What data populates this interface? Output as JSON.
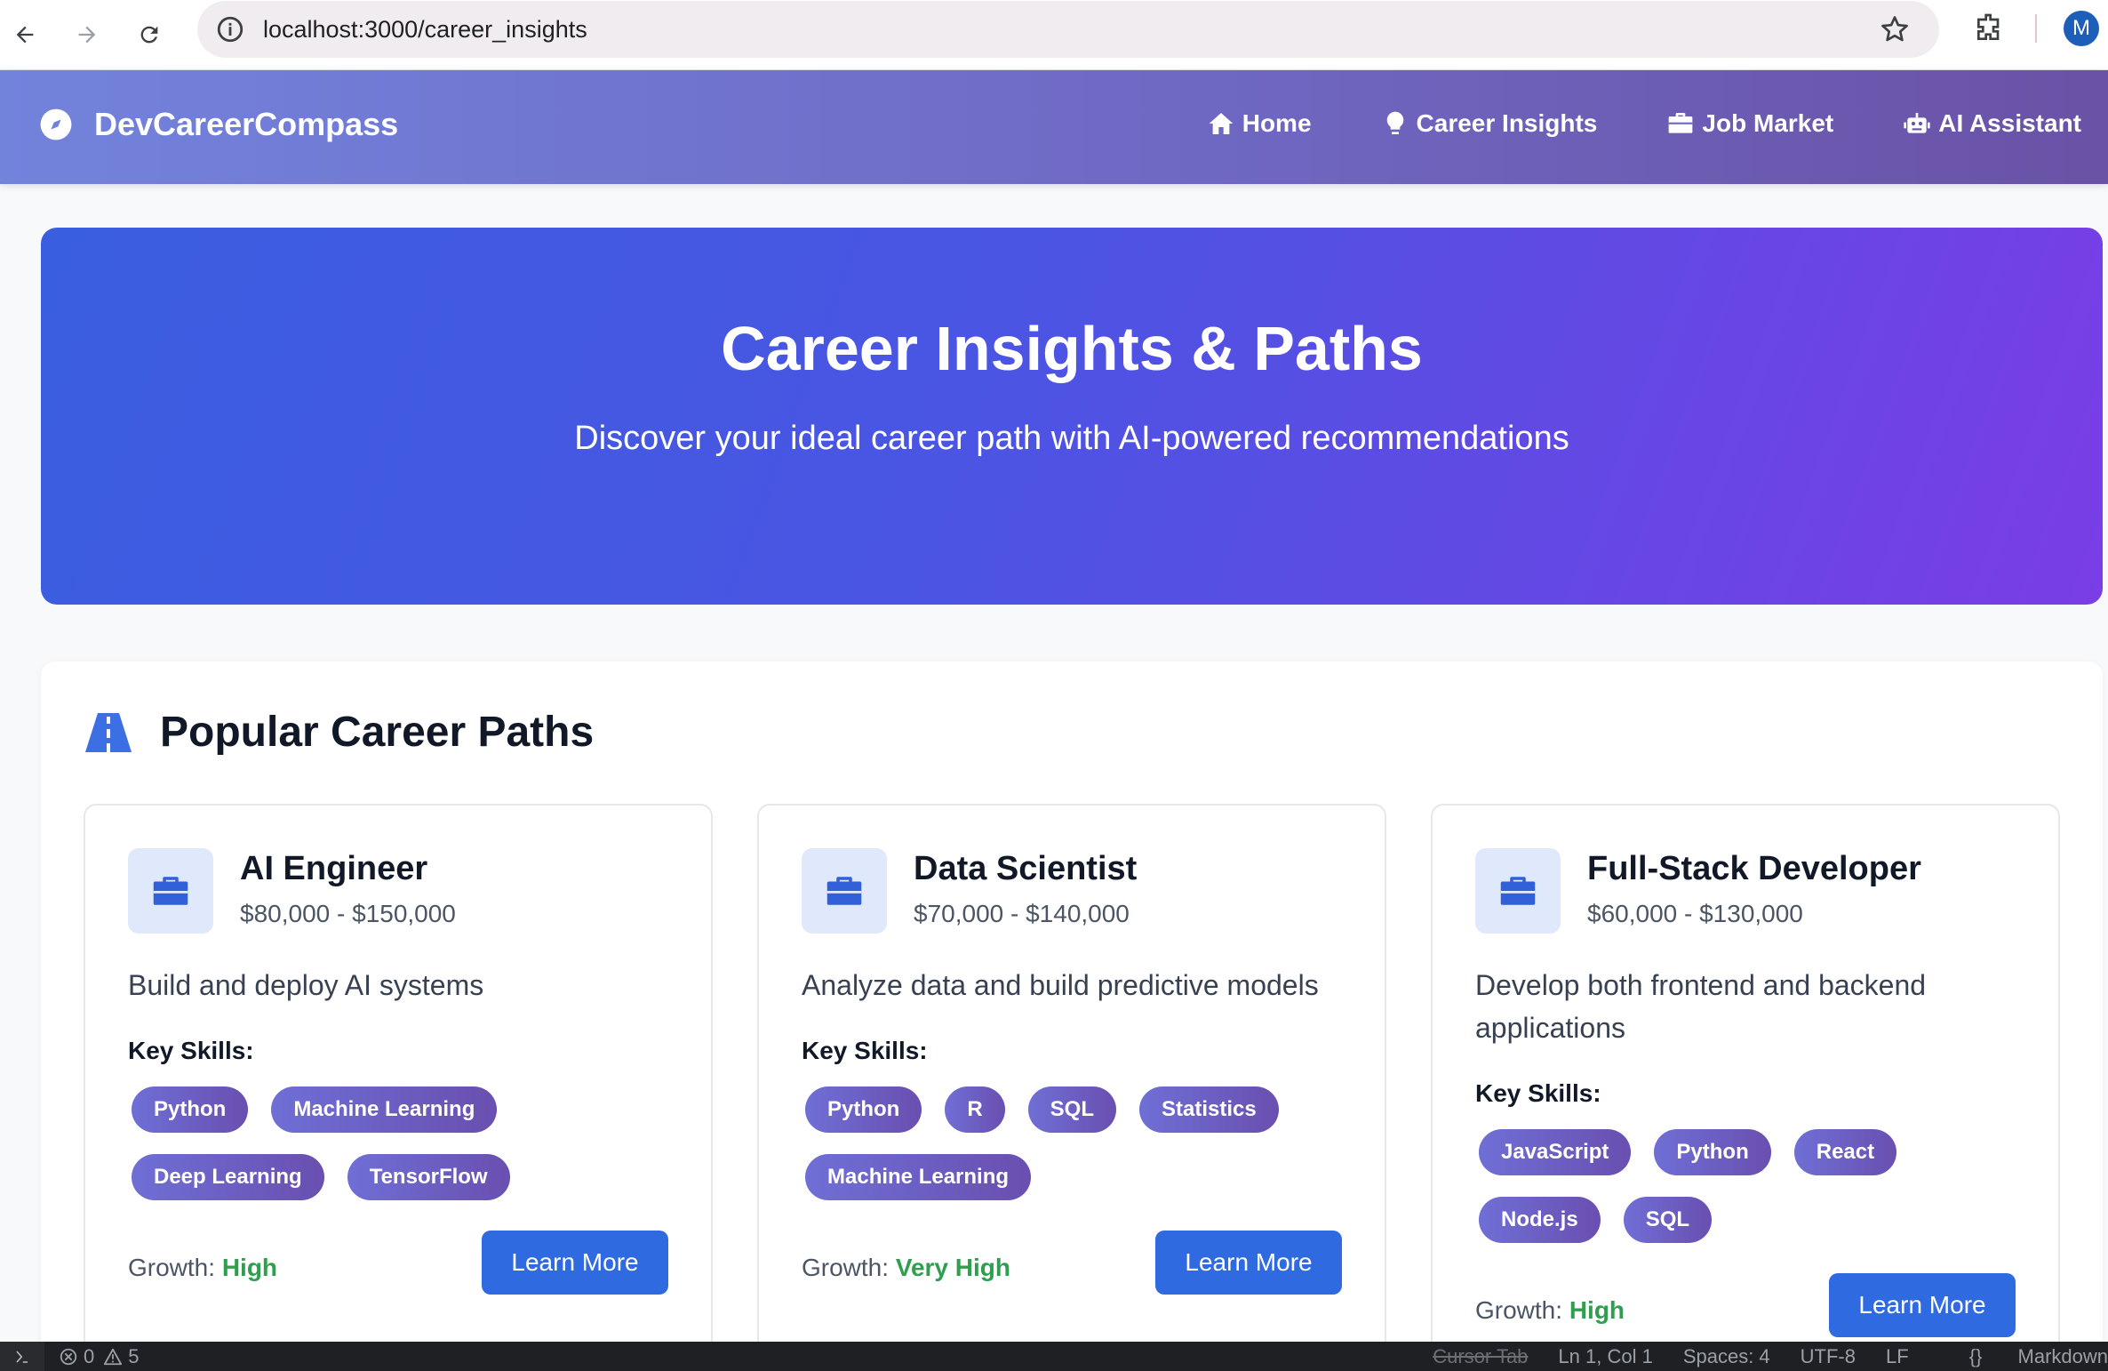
{
  "browser": {
    "url": "localhost:3000/career_insights",
    "avatar_letter": "M"
  },
  "nav": {
    "brand": "DevCareerCompass",
    "links": [
      {
        "label": "Home",
        "icon": "home-icon"
      },
      {
        "label": "Career Insights",
        "icon": "lightbulb-icon"
      },
      {
        "label": "Job Market",
        "icon": "briefcase-icon"
      },
      {
        "label": "AI Assistant",
        "icon": "robot-icon"
      }
    ]
  },
  "hero": {
    "title": "Career Insights & Paths",
    "subtitle": "Discover your ideal career path with AI-powered recommendations"
  },
  "section": {
    "title": "Popular Career Paths",
    "skills_label": "Key Skills:",
    "growth_label": "Growth:",
    "button_label": "Learn More"
  },
  "cards": [
    {
      "title": "AI Engineer",
      "salary": "$80,000 - $150,000",
      "description": "Build and deploy AI systems",
      "skills": [
        "Python",
        "Machine Learning",
        "Deep Learning",
        "TensorFlow"
      ],
      "growth": "High"
    },
    {
      "title": "Data Scientist",
      "salary": "$70,000 - $140,000",
      "description": "Analyze data and build predictive models",
      "skills": [
        "Python",
        "R",
        "SQL",
        "Statistics",
        "Machine Learning"
      ],
      "growth": "Very High"
    },
    {
      "title": "Full-Stack Developer",
      "salary": "$60,000 - $130,000",
      "description": "Develop both frontend and backend applications",
      "skills": [
        "JavaScript",
        "Python",
        "React",
        "Node.js",
        "SQL"
      ],
      "growth": "High"
    }
  ],
  "status": {
    "errors": "0",
    "warnings": "5",
    "cursor_tab": "Cursor Tab",
    "position": "Ln 1, Col 1",
    "spaces": "Spaces: 4",
    "encoding": "UTF-8",
    "eol": "LF",
    "language": "Markdown"
  },
  "colors": {
    "accent": "#2f6ae0",
    "growth_green": "#2f9e4f",
    "skill_pill": "#6a5bc4"
  }
}
